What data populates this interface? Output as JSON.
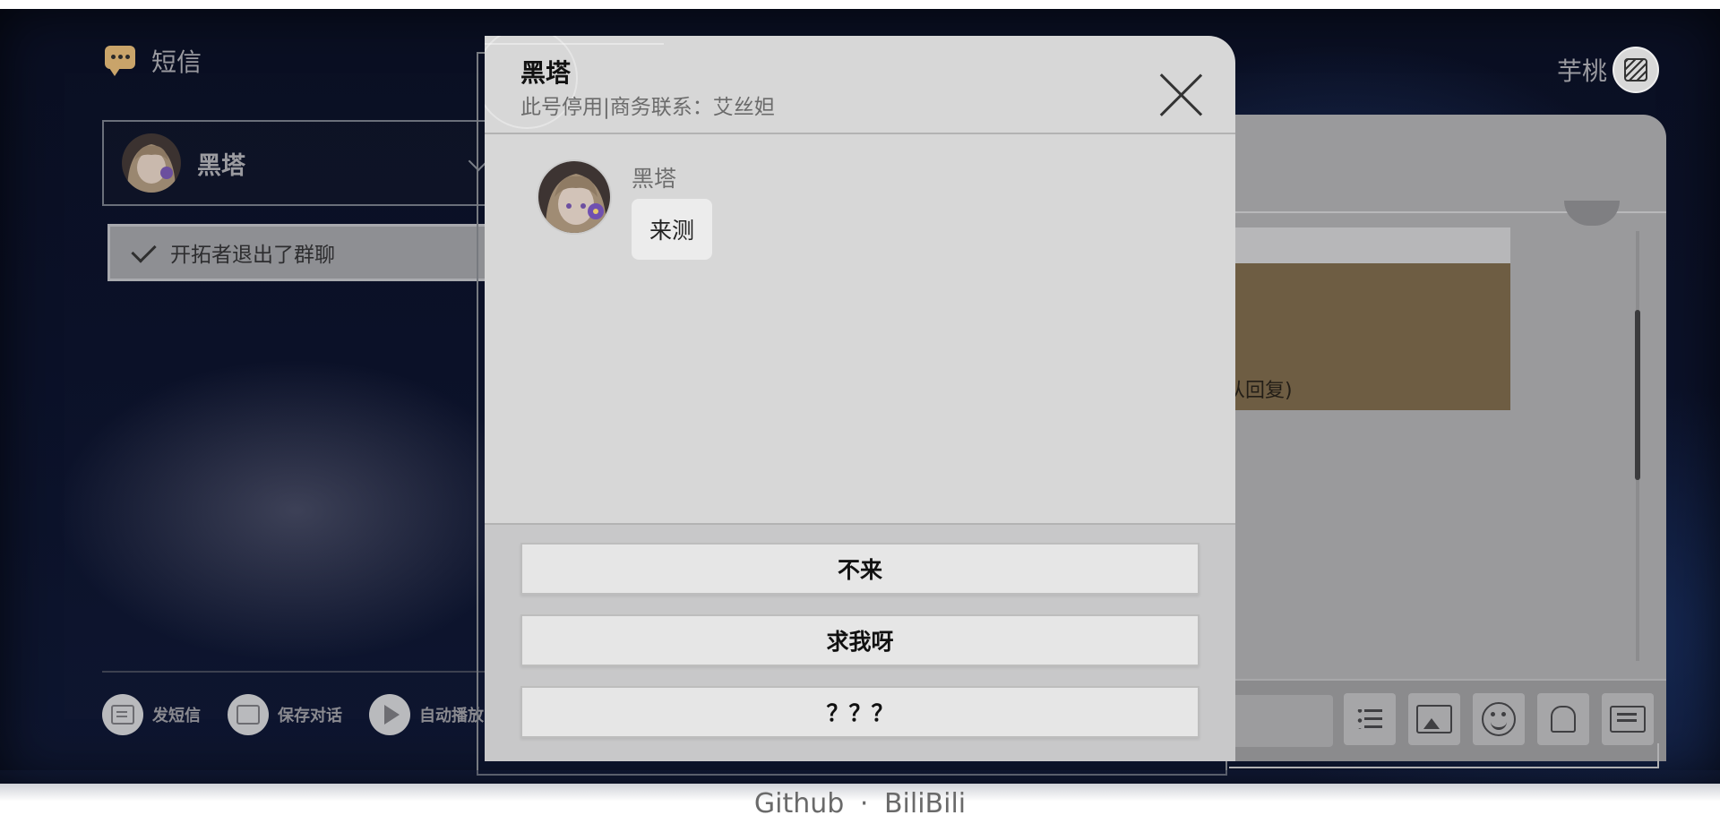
{
  "app": {
    "title": "短信"
  },
  "user": {
    "name": "芋桃"
  },
  "contact_select": {
    "name": "黑塔"
  },
  "notice": {
    "text": "开拓者退出了群聊"
  },
  "bottom_actions": [
    {
      "label": "发短信",
      "icon": "message-icon"
    },
    {
      "label": "保存对话",
      "icon": "image-icon"
    },
    {
      "label": "自动播放",
      "icon": "play-icon"
    }
  ],
  "background_panel": {
    "partial_text": "从回复)"
  },
  "dialog": {
    "title": "黑塔",
    "subtitle": "此号停用|商务联系：艾丝妲",
    "message": {
      "sender": "黑塔",
      "text": "来测"
    },
    "replies": [
      "不来",
      "求我呀",
      "？？？"
    ]
  },
  "footer": {
    "github": "Github",
    "separator": "·",
    "bilibili": "BiliBili"
  },
  "colors": {
    "accent": "#c9a46a",
    "dialog_bg": "#d7d7d7",
    "reply_btn_bg": "#e6e6e6",
    "scene_bg": "#0b1128"
  }
}
